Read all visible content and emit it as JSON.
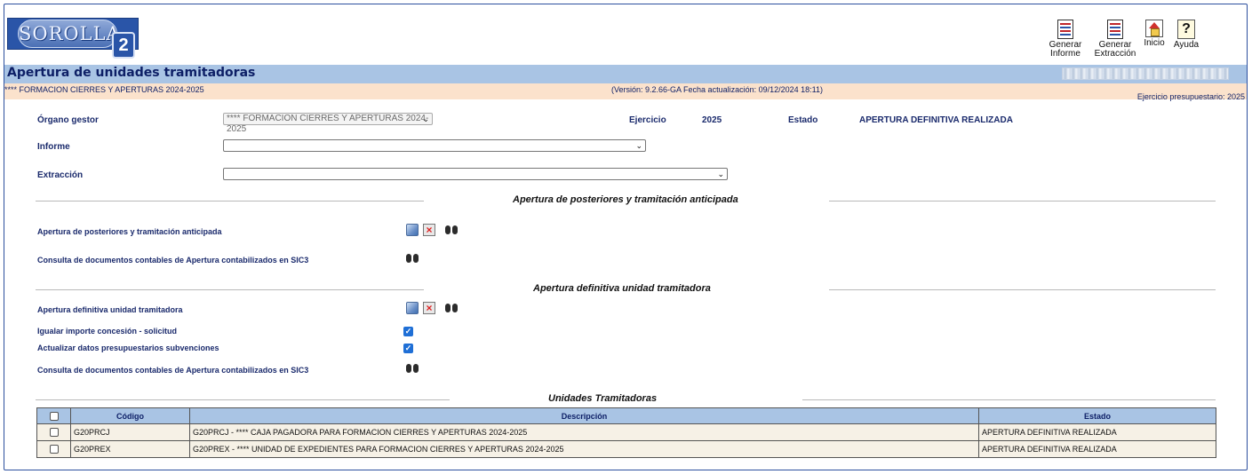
{
  "app": {
    "logo_text": "SOROLLA",
    "logo_suffix": "2"
  },
  "toolbar": {
    "report": {
      "label1": "Generar",
      "label2": "Informe",
      "icon": "report-icon"
    },
    "extract": {
      "label1": "Generar",
      "label2": "Extracción",
      "icon": "extract-icon"
    },
    "home": {
      "label": "Inicio",
      "icon": "home-icon"
    },
    "help": {
      "label": "Ayuda",
      "icon": "help-icon"
    }
  },
  "page": {
    "title": "Apertura de unidades tramitadoras",
    "organ_line": "**** FORMACION CIERRES Y APERTURAS 2024-2025",
    "version_line": "(Versión: 9.2.66-GA Fecha actualización: 09/12/2024 18:11)",
    "budget_year_line": "Ejercicio presupuestario: 2025"
  },
  "form": {
    "organo_label": "Órgano gestor",
    "organo_value": "**** FORMACION CIERRES Y APERTURAS 2024-2025",
    "ejercicio_label": "Ejercicio",
    "ejercicio_value": "2025",
    "estado_label": "Estado",
    "estado_value": "APERTURA DEFINITIVA REALIZADA",
    "informe_label": "Informe",
    "informe_value": "",
    "extraccion_label": "Extracción",
    "extraccion_value": ""
  },
  "section1": {
    "title": "Apertura de posteriores y tramitación anticipada",
    "row1_label": "Apertura de posteriores y tramitación anticipada",
    "row2_label": "Consulta de documentos contables de Apertura contabilizados en SIC3"
  },
  "section2": {
    "title": "Apertura definitiva unidad tramitadora",
    "row1_label": "Apertura definitiva unidad tramitadora",
    "row2_label": "Igualar importe concesión - solicitud",
    "row2_checked": true,
    "row3_label": "Actualizar datos presupuestarios subvenciones",
    "row3_checked": true,
    "row4_label": "Consulta de documentos contables de Apertura contabilizados en SIC3"
  },
  "units": {
    "title": "Unidades Tramitadoras",
    "headers": {
      "code": "Código",
      "description": "Descripción",
      "status": "Estado"
    },
    "rows": [
      {
        "checked": false,
        "code": "G20PRCJ",
        "description": "G20PRCJ - **** CAJA PAGADORA PARA FORMACION CIERRES Y APERTURAS 2024-2025",
        "status": "APERTURA DEFINITIVA REALIZADA"
      },
      {
        "checked": false,
        "code": "G20PREX",
        "description": "G20PREX - **** UNIDAD DE EXPEDIENTES PARA FORMACION CIERRES Y APERTURAS 2024-2025",
        "status": "APERTURA DEFINITIVA REALIZADA"
      }
    ]
  },
  "colors": {
    "title_band": "#a9c4e4",
    "info_band": "#fbe2cc",
    "table_row": "#f6f1e6",
    "checkbox_blue": "#1f6fd6"
  }
}
